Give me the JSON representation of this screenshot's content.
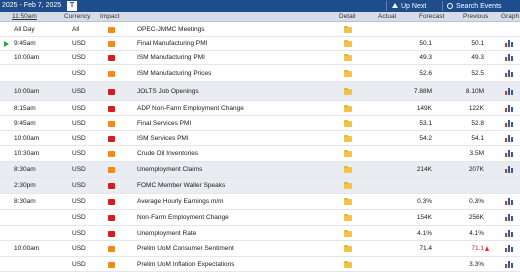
{
  "topbar": {
    "date_range": "2025 - Feb 7, 2025",
    "t_button": "T",
    "up_next": "Up Next",
    "search_events": "Search Events"
  },
  "header": {
    "time": "11:50am",
    "currency": "Currency",
    "impact": "Impact",
    "detail": "Detail",
    "actual": "Actual",
    "forecast": "Forecast",
    "previous": "Previous",
    "graph": "Graph"
  },
  "rows": [
    {
      "time": "All Day",
      "currency": "All",
      "impact": "medium",
      "event": "OPEC-JMMC Meetings",
      "forecast": "",
      "previous": "",
      "graph": false
    },
    {
      "time": "9:45am",
      "currency": "USD",
      "impact": "medium",
      "event": "Final Manufacturing PMI",
      "forecast": "50.1",
      "previous": "50.1",
      "graph": true
    },
    {
      "time": "10:00am",
      "currency": "USD",
      "impact": "high",
      "event": "ISM Manufacturing PMI",
      "forecast": "49.3",
      "previous": "49.3",
      "graph": true
    },
    {
      "time": "",
      "currency": "USD",
      "impact": "medium",
      "event": "ISM Manufacturing Prices",
      "forecast": "52.6",
      "previous": "52.5",
      "graph": true
    },
    {
      "time": "10:00am",
      "currency": "USD",
      "impact": "high",
      "event": "JOLTS Job Openings",
      "forecast": "7.88M",
      "previous": "8.10M",
      "graph": true
    },
    {
      "time": "8:15am",
      "currency": "USD",
      "impact": "high",
      "event": "ADP Non-Farm Employment Change",
      "forecast": "149K",
      "previous": "122K",
      "graph": true
    },
    {
      "time": "9:45am",
      "currency": "USD",
      "impact": "medium",
      "event": "Final Services PMI",
      "forecast": "53.1",
      "previous": "52.8",
      "graph": true
    },
    {
      "time": "10:00am",
      "currency": "USD",
      "impact": "high",
      "event": "ISM Services PMI",
      "forecast": "54.2",
      "previous": "54.1",
      "graph": true
    },
    {
      "time": "10:30am",
      "currency": "USD",
      "impact": "medium",
      "event": "Crude Oil Inventories",
      "forecast": "",
      "previous": "3.5M",
      "graph": true
    },
    {
      "time": "8:30am",
      "currency": "USD",
      "impact": "medium",
      "event": "Unemployment Claims",
      "forecast": "214K",
      "previous": "207K",
      "graph": true
    },
    {
      "time": "2:30pm",
      "currency": "USD",
      "impact": "high",
      "event": "FOMC Member Waller Speaks",
      "forecast": "",
      "previous": "",
      "graph": false
    },
    {
      "time": "8:30am",
      "currency": "USD",
      "impact": "high",
      "event": "Average Hourly Earnings m/m",
      "forecast": "0.3%",
      "previous": "0.3%",
      "graph": true
    },
    {
      "time": "",
      "currency": "USD",
      "impact": "high",
      "event": "Non-Farm Employment Change",
      "forecast": "154K",
      "previous": "256K",
      "graph": true
    },
    {
      "time": "",
      "currency": "USD",
      "impact": "high",
      "event": "Unemployment Rate",
      "forecast": "4.1%",
      "previous": "4.1%",
      "graph": true
    },
    {
      "time": "10:00am",
      "currency": "USD",
      "impact": "medium",
      "event": "Prelim UoM Consumer Sentiment",
      "forecast": "71.4",
      "previous": "71.1",
      "graph": true
    },
    {
      "time": "",
      "currency": "USD",
      "impact": "medium",
      "event": "Prelim UoM Inflation Expectations",
      "forecast": "",
      "previous": "3.3%",
      "graph": true
    }
  ],
  "colors": {
    "topbar": "#1f4d8c",
    "impact_high": "#cf1f1f",
    "impact_medium": "#f08a1c",
    "revised_previous": "#d21f1f"
  }
}
